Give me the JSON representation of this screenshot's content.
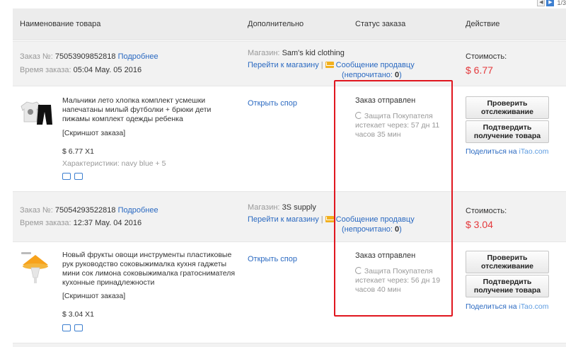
{
  "pager": {
    "prev": "◀",
    "next": "▶",
    "page": "1/3"
  },
  "columns": {
    "product": "Наименование товара",
    "extra": "Дополнительно",
    "status": "Статус заказа",
    "action": "Действие"
  },
  "orders": [
    {
      "order_label": "Заказ №:",
      "order_number": "75053909852818",
      "details_link": "Подробнее",
      "time_label": "Время заказа:",
      "time_value": "05:04 May. 05 2016",
      "store_label": "Магазин:",
      "store_name": "Sam's kid clothing",
      "go_to_store": "Перейти к магазину",
      "message_seller": "Сообщение продавцу",
      "unread_label": "(непрочитано:",
      "unread_count": "0",
      "unread_close": ")",
      "cost_label": "Стоимость:",
      "cost_value": "$ 6.77",
      "item": {
        "title": "Мальчики лето хлопка комплект усмешки напечатаны милый футболки + брюки дети пижамы комплект одежды ребенка",
        "snapshot": "[Скриншот заказа]",
        "price_qty": "$ 6.77 X1",
        "attributes": "Характеристики: navy blue + 5",
        "dispute": "Открыть спор",
        "status": "Заказ отправлен",
        "protection": "Защита Покупателя истекает через: 57 дн 11 часов 35 мин",
        "track_button": "Проверить отслеживание",
        "confirm_button": "Подтвердить получение товара",
        "share_prefix": "Поделиться на",
        "share_brand": "iTao.com"
      }
    },
    {
      "order_label": "Заказ №:",
      "order_number": "75054293522818",
      "details_link": "Подробнее",
      "time_label": "Время заказа:",
      "time_value": "12:37 May. 04 2016",
      "store_label": "Магазин:",
      "store_name": "3S supply",
      "go_to_store": "Перейти к магазину",
      "message_seller": "Сообщение продавцу",
      "unread_label": "(непрочитано:",
      "unread_count": "0",
      "unread_close": ")",
      "cost_label": "Стоимость:",
      "cost_value": "$ 3.04",
      "item": {
        "title": "Новый фрукты овощи инструменты пластиковые рук руководство соковыжималка кухня гаджеты мини сок лимона соковыжималка гратоснимателя кухонные принадлежности",
        "snapshot": "[Скриншот заказа]",
        "price_qty": "$ 3.04 X1",
        "attributes": "",
        "dispute": "Открыть спор",
        "status": "Заказ отправлен",
        "protection": "Защита Покупателя истекает через: 56 дн 19 часов 40 мин",
        "track_button": "Проверить отслеживание",
        "confirm_button": "Подтвердить получение товара",
        "share_prefix": "Поделиться на",
        "share_brand": "iTao.com"
      }
    }
  ],
  "colors": {
    "price": "#e4393c",
    "link": "#2a69c1",
    "highlight": "#e0161f"
  }
}
